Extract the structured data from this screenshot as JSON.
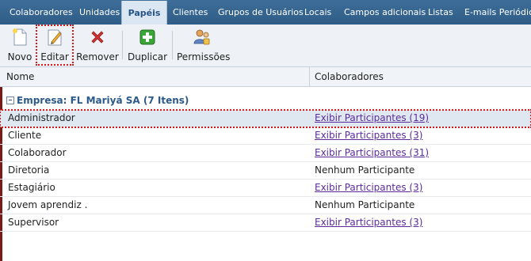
{
  "tabs": [
    "Colaboradores",
    "Unidades",
    "Papéis",
    "Clientes",
    "Grupos de Usuários",
    "Locais",
    "Campos adicionais",
    "Listas",
    "E-mails Periódicos"
  ],
  "active_tab": "Papéis",
  "toolbar": {
    "novo": "Novo",
    "editar": "Editar",
    "remover": "Remover",
    "duplicar": "Duplicar",
    "permissoes": "Permissões"
  },
  "grid": {
    "col_nome": "Nome",
    "col_colaboradores": "Colaboradores",
    "group_label": "Empresa: FL Mariyá SA (7 Itens)",
    "rows": [
      {
        "nome": "Administrador",
        "colaboradores": "Exibir Participantes (19)"
      },
      {
        "nome": "Cliente",
        "colaboradores": "Exibir Participantes (3)"
      },
      {
        "nome": "Colaborador",
        "colaboradores": "Exibir Participantes (31)"
      },
      {
        "nome": "Diretoria",
        "colaboradores": "Nenhum Participante"
      },
      {
        "nome": "Estagiário",
        "colaboradores": "Exibir Participantes (3)"
      },
      {
        "nome": "Jovem aprendiz .",
        "colaboradores": "Nenhum Participante"
      },
      {
        "nome": "Supervisor",
        "colaboradores": "Exibir Participantes (3)"
      }
    ]
  },
  "colors": {
    "tabbar": "#2f5d88",
    "link": "#5a2c9a",
    "highlight": "#d11b1b"
  },
  "icons": [
    "new-document-icon",
    "edit-pencil-icon",
    "remove-x-icon",
    "duplicate-plus-icon",
    "permissions-users-icon",
    "collapse-toggle-icon"
  ]
}
